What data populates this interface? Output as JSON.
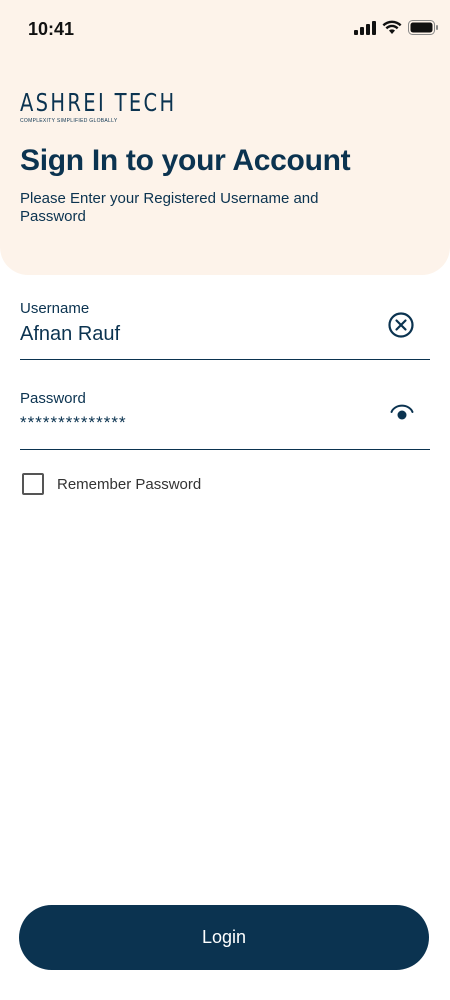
{
  "status_bar": {
    "time": "10:41",
    "icons": [
      "signal-icon",
      "wifi-icon",
      "battery-icon"
    ]
  },
  "brand": {
    "name": "ASHREI TECH",
    "tagline": "COMPLEXITY SIMPLIFIED GLOBALLY"
  },
  "header": {
    "title": "Sign In to your Account",
    "subtitle": "Please Enter your Registered Username and Password"
  },
  "form": {
    "username": {
      "label": "Username",
      "value": "Afnan Rauf",
      "icon": "clear-icon"
    },
    "password": {
      "label": "Password",
      "value": "**************",
      "icon": "eye-icon"
    },
    "remember": {
      "label": "Remember Password",
      "checked": false
    }
  },
  "login_button": {
    "label": "Login"
  },
  "colors": {
    "primary": "#0b3350",
    "header_bg": "#fdf3ea",
    "background": "#ffffff"
  }
}
